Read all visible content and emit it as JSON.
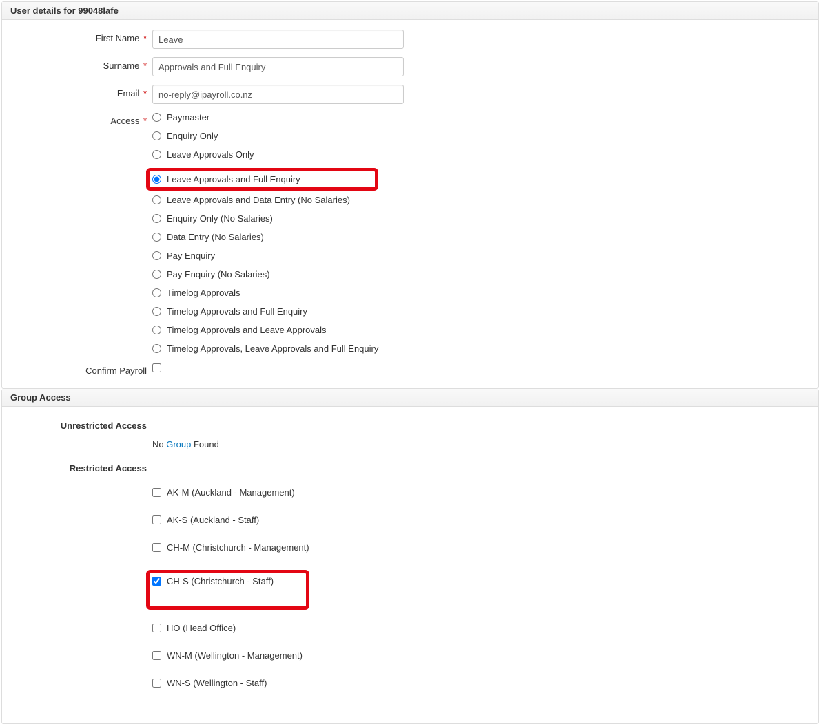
{
  "userDetails": {
    "heading": "User details for 99048lafe",
    "labels": {
      "firstName": "First Name",
      "surname": "Surname",
      "email": "Email",
      "access": "Access",
      "confirmPayroll": "Confirm Payroll"
    },
    "values": {
      "firstName": "Leave",
      "surname": "Approvals and Full Enquiry",
      "email": "no-reply@ipayroll.co.nz"
    },
    "accessOptions": [
      "Paymaster",
      "Enquiry Only",
      "Leave Approvals Only",
      "Leave Approvals and Full Enquiry",
      "Leave Approvals and Data Entry (No Salaries)",
      "Enquiry Only (No Salaries)",
      "Data Entry (No Salaries)",
      "Pay Enquiry",
      "Pay Enquiry (No Salaries)",
      "Timelog Approvals",
      "Timelog Approvals and Full Enquiry",
      "Timelog Approvals and Leave Approvals",
      "Timelog Approvals, Leave Approvals and Full Enquiry"
    ],
    "accessSelectedIndex": 3,
    "confirmPayrollChecked": false
  },
  "groupAccess": {
    "heading": "Group Access",
    "unrestrictedLabel": "Unrestricted Access",
    "restrictedLabel": "Restricted Access",
    "noGroupPrefix": "No ",
    "groupLinkText": "Group",
    "noGroupSuffix": " Found",
    "restrictedOptions": [
      "AK-M (Auckland - Management)",
      "AK-S (Auckland - Staff)",
      "CH-M (Christchurch - Management)",
      "CH-S (Christchurch - Staff)",
      "HO (Head Office)",
      "WN-M (Wellington - Management)",
      "WN-S (Wellington - Staff)"
    ],
    "restrictedCheckedIndex": 3
  }
}
